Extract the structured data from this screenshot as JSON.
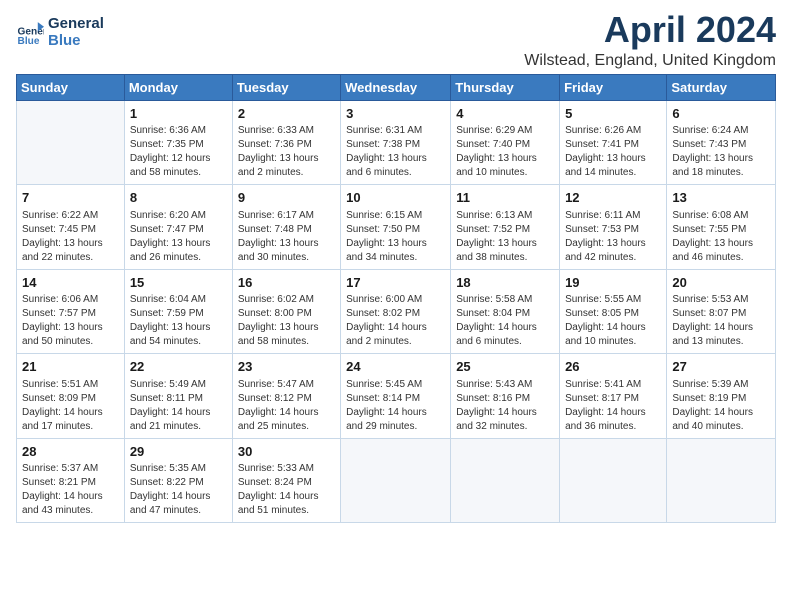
{
  "header": {
    "logo_line1": "General",
    "logo_line2": "Blue",
    "title": "April 2024",
    "location": "Wilstead, England, United Kingdom"
  },
  "weekdays": [
    "Sunday",
    "Monday",
    "Tuesday",
    "Wednesday",
    "Thursday",
    "Friday",
    "Saturday"
  ],
  "weeks": [
    [
      {
        "day": "",
        "info": ""
      },
      {
        "day": "1",
        "info": "Sunrise: 6:36 AM\nSunset: 7:35 PM\nDaylight: 12 hours\nand 58 minutes."
      },
      {
        "day": "2",
        "info": "Sunrise: 6:33 AM\nSunset: 7:36 PM\nDaylight: 13 hours\nand 2 minutes."
      },
      {
        "day": "3",
        "info": "Sunrise: 6:31 AM\nSunset: 7:38 PM\nDaylight: 13 hours\nand 6 minutes."
      },
      {
        "day": "4",
        "info": "Sunrise: 6:29 AM\nSunset: 7:40 PM\nDaylight: 13 hours\nand 10 minutes."
      },
      {
        "day": "5",
        "info": "Sunrise: 6:26 AM\nSunset: 7:41 PM\nDaylight: 13 hours\nand 14 minutes."
      },
      {
        "day": "6",
        "info": "Sunrise: 6:24 AM\nSunset: 7:43 PM\nDaylight: 13 hours\nand 18 minutes."
      }
    ],
    [
      {
        "day": "7",
        "info": "Sunrise: 6:22 AM\nSunset: 7:45 PM\nDaylight: 13 hours\nand 22 minutes."
      },
      {
        "day": "8",
        "info": "Sunrise: 6:20 AM\nSunset: 7:47 PM\nDaylight: 13 hours\nand 26 minutes."
      },
      {
        "day": "9",
        "info": "Sunrise: 6:17 AM\nSunset: 7:48 PM\nDaylight: 13 hours\nand 30 minutes."
      },
      {
        "day": "10",
        "info": "Sunrise: 6:15 AM\nSunset: 7:50 PM\nDaylight: 13 hours\nand 34 minutes."
      },
      {
        "day": "11",
        "info": "Sunrise: 6:13 AM\nSunset: 7:52 PM\nDaylight: 13 hours\nand 38 minutes."
      },
      {
        "day": "12",
        "info": "Sunrise: 6:11 AM\nSunset: 7:53 PM\nDaylight: 13 hours\nand 42 minutes."
      },
      {
        "day": "13",
        "info": "Sunrise: 6:08 AM\nSunset: 7:55 PM\nDaylight: 13 hours\nand 46 minutes."
      }
    ],
    [
      {
        "day": "14",
        "info": "Sunrise: 6:06 AM\nSunset: 7:57 PM\nDaylight: 13 hours\nand 50 minutes."
      },
      {
        "day": "15",
        "info": "Sunrise: 6:04 AM\nSunset: 7:59 PM\nDaylight: 13 hours\nand 54 minutes."
      },
      {
        "day": "16",
        "info": "Sunrise: 6:02 AM\nSunset: 8:00 PM\nDaylight: 13 hours\nand 58 minutes."
      },
      {
        "day": "17",
        "info": "Sunrise: 6:00 AM\nSunset: 8:02 PM\nDaylight: 14 hours\nand 2 minutes."
      },
      {
        "day": "18",
        "info": "Sunrise: 5:58 AM\nSunset: 8:04 PM\nDaylight: 14 hours\nand 6 minutes."
      },
      {
        "day": "19",
        "info": "Sunrise: 5:55 AM\nSunset: 8:05 PM\nDaylight: 14 hours\nand 10 minutes."
      },
      {
        "day": "20",
        "info": "Sunrise: 5:53 AM\nSunset: 8:07 PM\nDaylight: 14 hours\nand 13 minutes."
      }
    ],
    [
      {
        "day": "21",
        "info": "Sunrise: 5:51 AM\nSunset: 8:09 PM\nDaylight: 14 hours\nand 17 minutes."
      },
      {
        "day": "22",
        "info": "Sunrise: 5:49 AM\nSunset: 8:11 PM\nDaylight: 14 hours\nand 21 minutes."
      },
      {
        "day": "23",
        "info": "Sunrise: 5:47 AM\nSunset: 8:12 PM\nDaylight: 14 hours\nand 25 minutes."
      },
      {
        "day": "24",
        "info": "Sunrise: 5:45 AM\nSunset: 8:14 PM\nDaylight: 14 hours\nand 29 minutes."
      },
      {
        "day": "25",
        "info": "Sunrise: 5:43 AM\nSunset: 8:16 PM\nDaylight: 14 hours\nand 32 minutes."
      },
      {
        "day": "26",
        "info": "Sunrise: 5:41 AM\nSunset: 8:17 PM\nDaylight: 14 hours\nand 36 minutes."
      },
      {
        "day": "27",
        "info": "Sunrise: 5:39 AM\nSunset: 8:19 PM\nDaylight: 14 hours\nand 40 minutes."
      }
    ],
    [
      {
        "day": "28",
        "info": "Sunrise: 5:37 AM\nSunset: 8:21 PM\nDaylight: 14 hours\nand 43 minutes."
      },
      {
        "day": "29",
        "info": "Sunrise: 5:35 AM\nSunset: 8:22 PM\nDaylight: 14 hours\nand 47 minutes."
      },
      {
        "day": "30",
        "info": "Sunrise: 5:33 AM\nSunset: 8:24 PM\nDaylight: 14 hours\nand 51 minutes."
      },
      {
        "day": "",
        "info": ""
      },
      {
        "day": "",
        "info": ""
      },
      {
        "day": "",
        "info": ""
      },
      {
        "day": "",
        "info": ""
      }
    ]
  ]
}
